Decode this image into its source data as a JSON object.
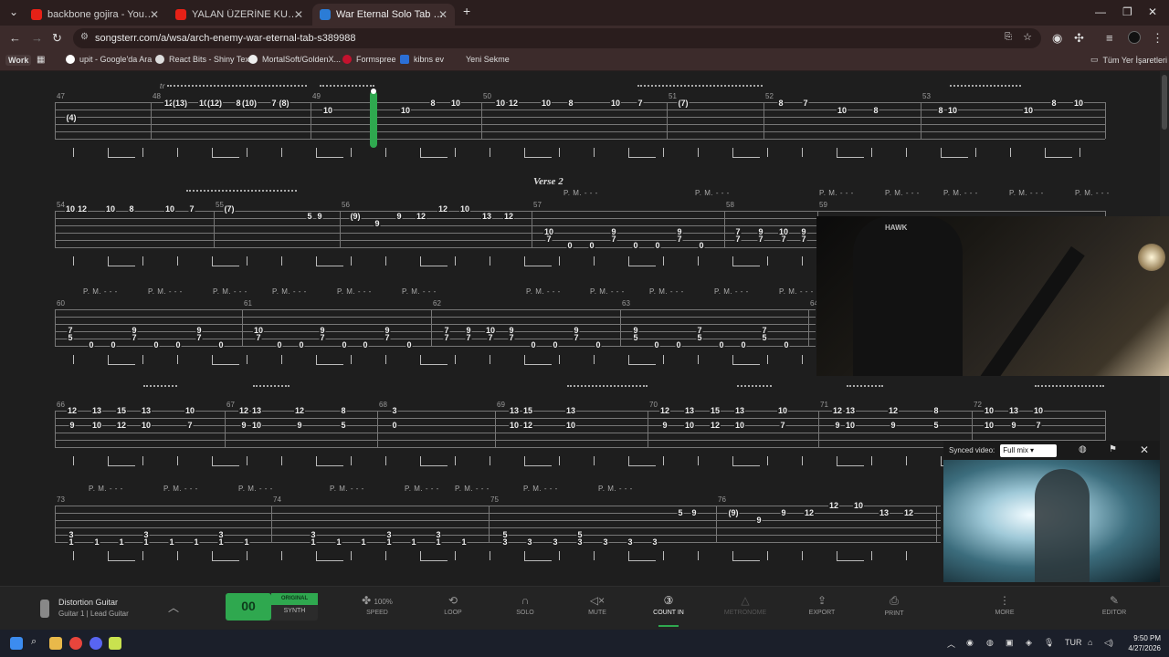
{
  "browser": {
    "tabs": [
      {
        "title": "backbone gojira - YouTube",
        "color": "#e62117"
      },
      {
        "title": "YALAN ÜZERİNE KURULMUŞ K",
        "color": "#e62117"
      },
      {
        "title": "War Eternal Solo Tab by Arc",
        "color": "#2b7cd6"
      }
    ],
    "new_tab": "+",
    "url": "songsterr.com/a/wsa/arch-enemy-war-eternal-tab-s389988",
    "bookmarks": {
      "work": "Work",
      "items": [
        "upit - Google'da Ara",
        "React Bits - Shiny Text",
        "MortalSoft/GoldenX...",
        "Formspree",
        "kibns ev",
        "Yeni Sekme"
      ],
      "all": "Tüm Yer İşaretleri"
    }
  },
  "tab_view": {
    "section": "Verse 2",
    "pm_label": "P. M.",
    "tr_label": "tr",
    "measures_row1": [
      "47",
      "48",
      "49",
      "50",
      "51",
      "52",
      "53"
    ],
    "measures_row2": [
      "54",
      "55",
      "56",
      "57",
      "58",
      "59"
    ],
    "measures_row3": [
      "60",
      "61",
      "62",
      "63",
      "64"
    ],
    "measures_row4": [
      "66",
      "67",
      "68",
      "69",
      "70",
      "71",
      "72"
    ],
    "measures_row5": [
      "73",
      "74",
      "75",
      "76"
    ]
  },
  "synced_video": {
    "label": "Synced video:",
    "mix": "Full mix"
  },
  "toolbar": {
    "instrument": "Distortion Guitar",
    "track": "Guitar 1 | Lead Guitar",
    "play_symbol": "00",
    "original": "ORIGINAL",
    "synth": "SYNTH",
    "speed_value": "100%",
    "speed": "SPEED",
    "loop": "LOOP",
    "solo": "SOLO",
    "mute": "MUTE",
    "count_in": "COUNT IN",
    "metronome": "METRONOME",
    "export": "EXPORT",
    "print": "PRINT",
    "more": "MORE",
    "editor": "EDITOR"
  },
  "taskbar": {
    "lang": "TUR",
    "time": "9:50 PM",
    "date": "4/27/2026"
  }
}
